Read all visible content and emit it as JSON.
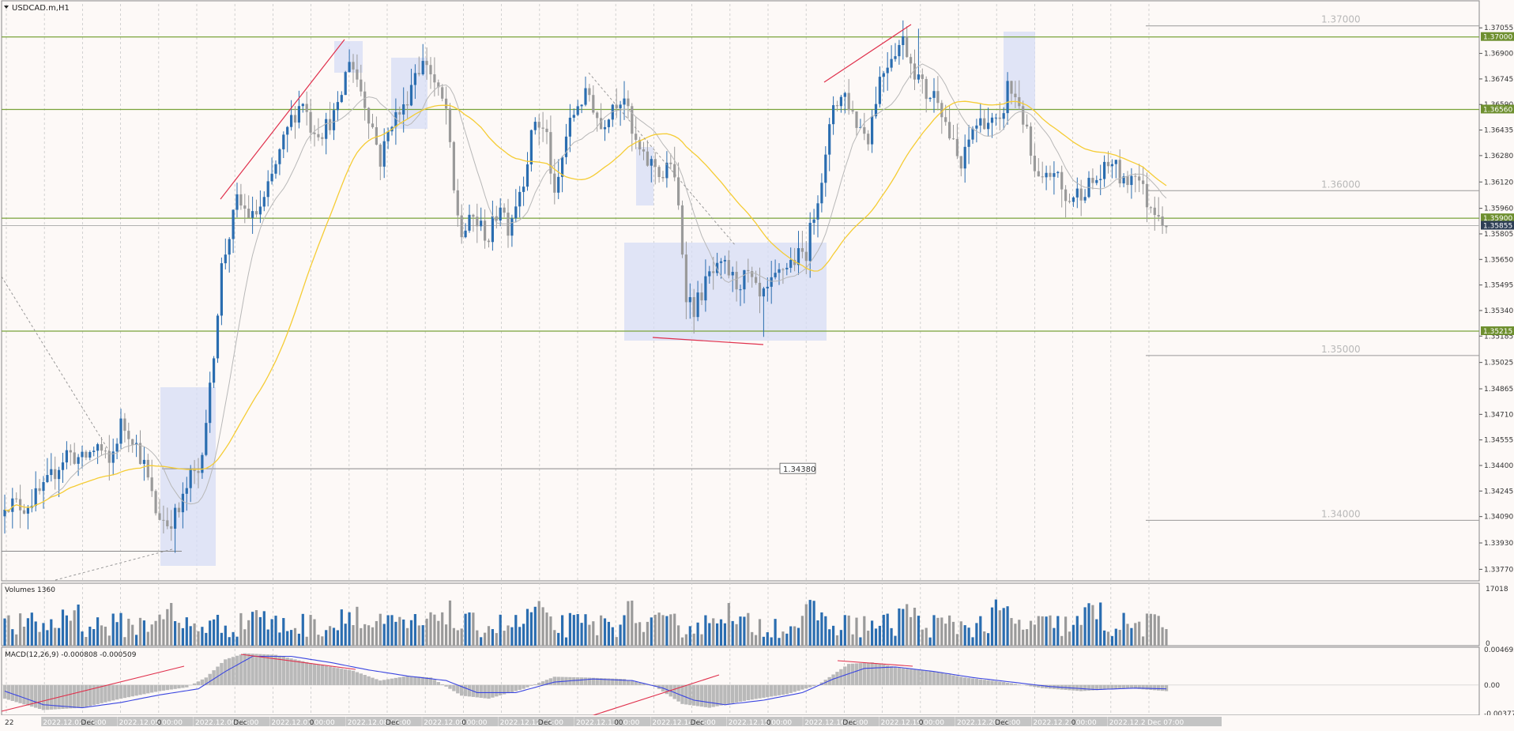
{
  "window": {
    "title": "USDCAD.m,H1"
  },
  "colors": {
    "background": "#fdf9f7",
    "bull": "#2a6db0",
    "bear": "#9a9a9a",
    "level": "#7aa33b",
    "ma_slow": "#f5cc34",
    "ma_fast": "#b8b8b8",
    "trend": "#e0304c",
    "zone": "#d6dcf5",
    "macd_signal": "#3b46e0"
  },
  "chart_data": [
    {
      "type": "candlestick",
      "symbol": "USDCAD.m",
      "timeframe": "H1",
      "ylim": [
        1.337,
        1.372
      ],
      "y_ticks": [
        "1.37055",
        "1.36900",
        "1.36745",
        "1.36590",
        "1.36435",
        "1.36280",
        "1.36120",
        "1.35960",
        "1.35805",
        "1.35650",
        "1.35495",
        "1.35340",
        "1.35185",
        "1.35025",
        "1.34865",
        "1.34710",
        "1.34555",
        "1.34400",
        "1.34245",
        "1.34090",
        "1.33930",
        "1.33770"
      ],
      "horizontal_levels": [
        {
          "value": 1.37,
          "label": "1.37000"
        },
        {
          "value": 1.3656,
          "label": "1.36560"
        },
        {
          "value": 1.359,
          "label": "1.35900"
        },
        {
          "value": 1.35215,
          "label": "1.35215"
        }
      ],
      "round_levels": [
        {
          "value": 1.37,
          "label": "1.37000"
        },
        {
          "value": 1.36,
          "label": "1.36000"
        },
        {
          "value": 1.35,
          "label": "1.35000"
        },
        {
          "value": 1.34,
          "label": "1.34000"
        }
      ],
      "current_price": {
        "value": 1.35855,
        "label": "1.35855"
      },
      "price_marker": {
        "value": 1.3438,
        "label": "1.34380"
      },
      "close_path": [
        [
          0,
          1.3418
        ],
        [
          5,
          1.3415
        ],
        [
          10,
          1.3425
        ],
        [
          16,
          1.3448
        ],
        [
          20,
          1.3443
        ],
        [
          24,
          1.3452
        ],
        [
          27,
          1.344
        ],
        [
          30,
          1.3465
        ],
        [
          33,
          1.3458
        ],
        [
          36,
          1.344
        ],
        [
          39,
          1.3412
        ],
        [
          42,
          1.3405
        ],
        [
          45,
          1.3412
        ],
        [
          48,
          1.3433
        ],
        [
          50,
          1.3436
        ],
        [
          53,
          1.3485
        ],
        [
          56,
          1.356
        ],
        [
          60,
          1.36
        ],
        [
          64,
          1.359
        ],
        [
          67,
          1.36
        ],
        [
          70,
          1.3622
        ],
        [
          74,
          1.365
        ],
        [
          77,
          1.3662
        ],
        [
          79,
          1.3646
        ],
        [
          82,
          1.3643
        ],
        [
          86,
          1.3655
        ],
        [
          89,
          1.3688
        ],
        [
          92,
          1.3668
        ],
        [
          95,
          1.3645
        ],
        [
          97,
          1.3625
        ],
        [
          100,
          1.365
        ],
        [
          103,
          1.3656
        ],
        [
          106,
          1.368
        ],
        [
          109,
          1.3685
        ],
        [
          112,
          1.3665
        ],
        [
          114,
          1.3656
        ],
        [
          116,
          1.3605
        ],
        [
          118,
          1.358
        ],
        [
          121,
          1.359
        ],
        [
          125,
          1.3578
        ],
        [
          128,
          1.36
        ],
        [
          130,
          1.3585
        ],
        [
          134,
          1.3615
        ],
        [
          137,
          1.365
        ],
        [
          140,
          1.364
        ],
        [
          142,
          1.36
        ],
        [
          145,
          1.364
        ],
        [
          148,
          1.366
        ],
        [
          151,
          1.3665
        ],
        [
          154,
          1.3645
        ],
        [
          157,
          1.366
        ],
        [
          160,
          1.3665
        ],
        [
          162,
          1.364
        ],
        [
          165,
          1.3625
        ],
        [
          168,
          1.3622
        ],
        [
          170,
          1.3615
        ],
        [
          172,
          1.3625
        ],
        [
          174,
          1.3596
        ],
        [
          176,
          1.3545
        ],
        [
          178,
          1.3535
        ],
        [
          182,
          1.3555
        ],
        [
          186,
          1.356
        ],
        [
          189,
          1.355
        ],
        [
          192,
          1.3555
        ],
        [
          195,
          1.354
        ],
        [
          197,
          1.3545
        ],
        [
          201,
          1.356
        ],
        [
          204,
          1.3565
        ],
        [
          207,
          1.357
        ],
        [
          210,
          1.3605
        ],
        [
          212,
          1.3625
        ],
        [
          214,
          1.366
        ],
        [
          217,
          1.3665
        ],
        [
          220,
          1.3648
        ],
        [
          223,
          1.364
        ],
        [
          226,
          1.3675
        ],
        [
          229,
          1.369
        ],
        [
          232,
          1.3698
        ],
        [
          235,
          1.368
        ],
        [
          238,
          1.3665
        ],
        [
          241,
          1.3665
        ],
        [
          244,
          1.364
        ],
        [
          247,
          1.362
        ],
        [
          250,
          1.3645
        ],
        [
          253,
          1.365
        ],
        [
          257,
          1.3645
        ],
        [
          259,
          1.367
        ],
        [
          262,
          1.366
        ],
        [
          264,
          1.364
        ],
        [
          266,
          1.3615
        ],
        [
          268,
          1.361
        ],
        [
          271,
          1.362
        ],
        [
          274,
          1.36
        ],
        [
          277,
          1.3605
        ],
        [
          280,
          1.361
        ],
        [
          283,
          1.3615
        ],
        [
          286,
          1.3625
        ],
        [
          289,
          1.361
        ],
        [
          292,
          1.362
        ],
        [
          295,
          1.36
        ],
        [
          298,
          1.3595
        ],
        [
          300,
          1.3586
        ]
      ],
      "bar_count": 301,
      "x_ticks": [
        "22",
        "2022.12.02 00:00",
        "Dec",
        "2022.12.05 00:00",
        "0",
        "2022.12.06 00:00",
        "Dec",
        "2022.12.07 00:00",
        "0",
        "2022.12.08 00:00",
        "Dec",
        "2022.12.09 00:00",
        "0",
        "2022.12.12 00:00",
        "Dec",
        "2022.12.13 00:00",
        "00",
        "2022.12.14 00:00",
        "Dec",
        "2022.12.15 00:00",
        "0",
        "2022.12.16 00:00",
        "Dec",
        "2022.12.19 00:00",
        "0",
        "2022.12.20 00:00",
        "Dec",
        "2022.12.21 00:00",
        "0",
        "2022.12.22 00:00",
        "Dec 07:00"
      ]
    },
    {
      "type": "bar",
      "title": "Volumes 1360",
      "ylim": [
        0,
        17018
      ],
      "y_ticks": [
        "17018",
        "0"
      ]
    },
    {
      "type": "bar",
      "title": "MACD(12,26,9) -0.000808 -0.000509",
      "ylim": [
        -0.003776,
        0.004692
      ],
      "y_ticks": [
        "0.004692",
        "0.00",
        "-0.003776"
      ],
      "macd_path": [
        [
          0,
          -0.0018
        ],
        [
          10,
          -0.0033
        ],
        [
          20,
          -0.003
        ],
        [
          30,
          -0.0018
        ],
        [
          40,
          -0.0008
        ],
        [
          47,
          -0.0003
        ],
        [
          52,
          0.001
        ],
        [
          57,
          0.0034
        ],
        [
          62,
          0.0042
        ],
        [
          70,
          0.004
        ],
        [
          80,
          0.0028
        ],
        [
          90,
          0.0019
        ],
        [
          97,
          0.0006
        ],
        [
          104,
          0.0012
        ],
        [
          110,
          0.001
        ],
        [
          118,
          -0.0014
        ],
        [
          125,
          -0.0018
        ],
        [
          134,
          -0.0005
        ],
        [
          142,
          0.0011
        ],
        [
          150,
          0.001
        ],
        [
          160,
          0.0008
        ],
        [
          168,
          -0.0002
        ],
        [
          175,
          -0.0025
        ],
        [
          182,
          -0.003
        ],
        [
          192,
          -0.002
        ],
        [
          202,
          -0.0012
        ],
        [
          210,
          0.0
        ],
        [
          218,
          0.0028
        ],
        [
          224,
          0.003
        ],
        [
          232,
          0.0022
        ],
        [
          240,
          0.0018
        ],
        [
          248,
          0.001
        ],
        [
          258,
          0.0004
        ],
        [
          268,
          -0.0004
        ],
        [
          278,
          -0.0008
        ],
        [
          290,
          -0.0004
        ],
        [
          300,
          -0.0008
        ]
      ],
      "signal_path": [
        [
          0,
          -0.0008
        ],
        [
          10,
          -0.0026
        ],
        [
          20,
          -0.003
        ],
        [
          30,
          -0.0023
        ],
        [
          40,
          -0.0013
        ],
        [
          50,
          -0.0005
        ],
        [
          57,
          0.0018
        ],
        [
          64,
          0.0038
        ],
        [
          74,
          0.0038
        ],
        [
          84,
          0.003
        ],
        [
          94,
          0.002
        ],
        [
          104,
          0.0012
        ],
        [
          114,
          0.0006
        ],
        [
          122,
          -0.001
        ],
        [
          132,
          -0.001
        ],
        [
          142,
          0.0004
        ],
        [
          152,
          0.0008
        ],
        [
          162,
          0.0006
        ],
        [
          170,
          -0.0004
        ],
        [
          178,
          -0.002
        ],
        [
          186,
          -0.0026
        ],
        [
          196,
          -0.002
        ],
        [
          206,
          -0.001
        ],
        [
          214,
          0.0008
        ],
        [
          222,
          0.0022
        ],
        [
          230,
          0.0024
        ],
        [
          240,
          0.0018
        ],
        [
          250,
          0.001
        ],
        [
          260,
          0.0004
        ],
        [
          270,
          -0.0002
        ],
        [
          282,
          -0.0006
        ],
        [
          292,
          -0.0004
        ],
        [
          300,
          -0.0005
        ]
      ]
    }
  ]
}
